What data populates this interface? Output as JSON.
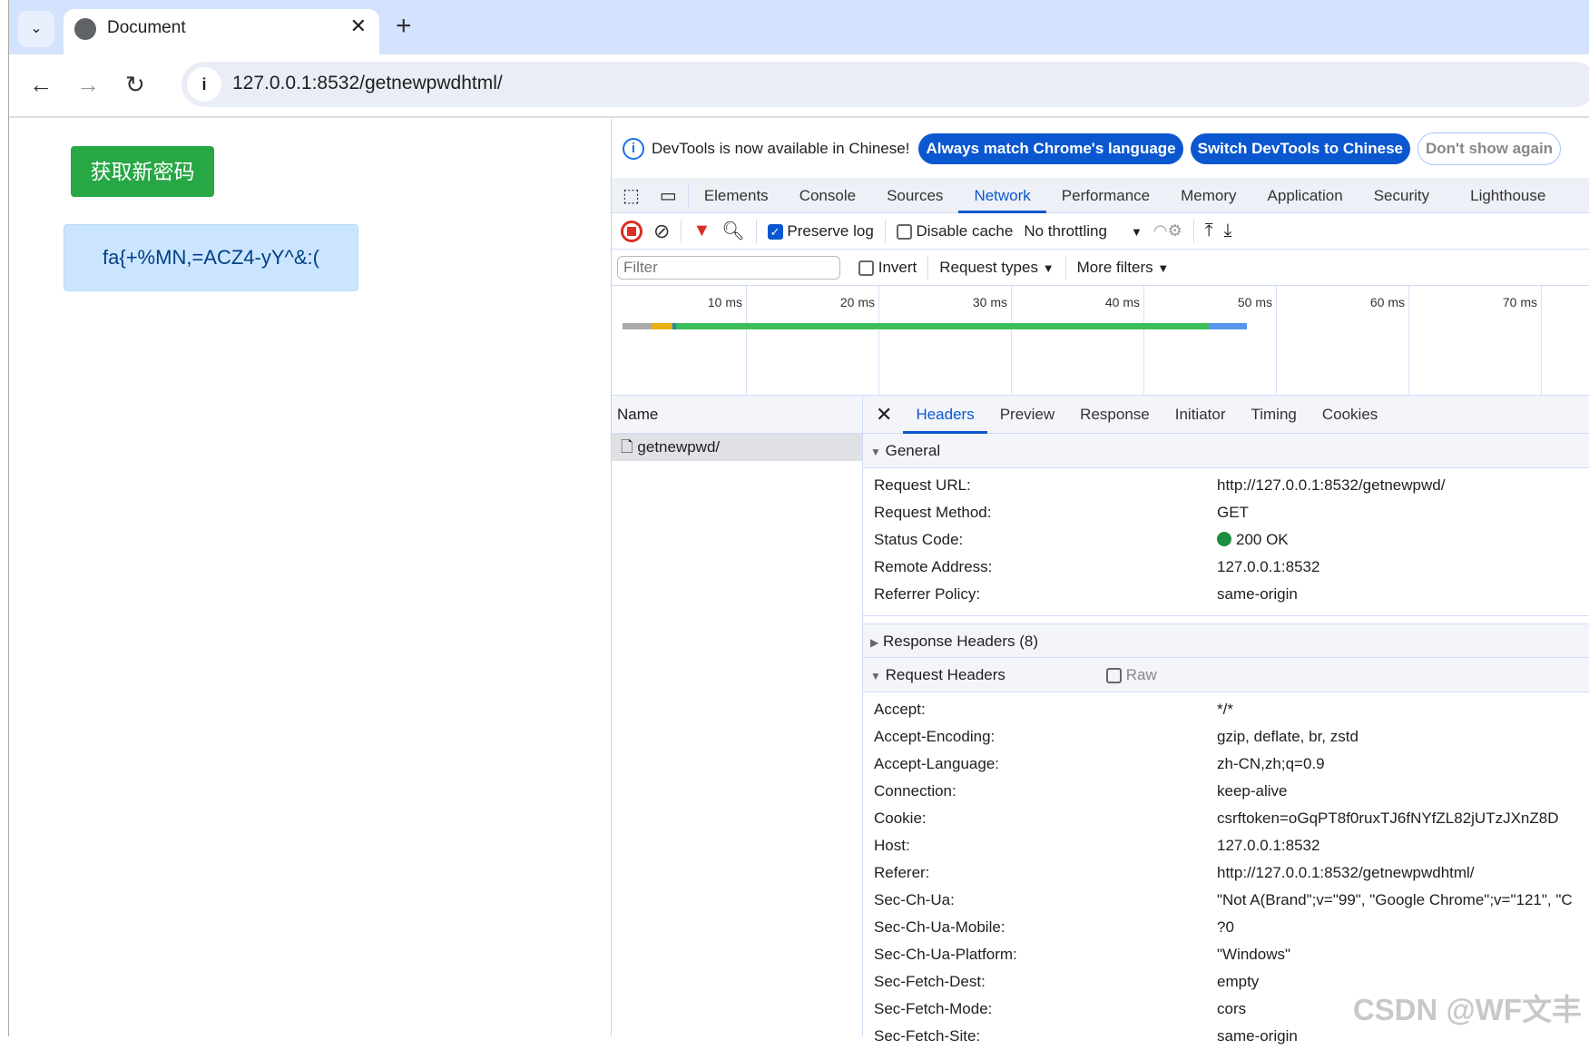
{
  "browser": {
    "tab_title": "Document",
    "url": "127.0.0.1:8532/getnewpwdhtml/"
  },
  "page": {
    "button_label": "获取新密码",
    "password": "fa{+%MN,=ACZ4-yY^&:("
  },
  "devtools": {
    "infobar": {
      "message": "DevTools is now available in Chinese!",
      "btn_match": "Always match Chrome's language",
      "btn_switch": "Switch DevTools to Chinese",
      "btn_dismiss": "Don't show again"
    },
    "panels": [
      "Elements",
      "Console",
      "Sources",
      "Network",
      "Performance",
      "Memory",
      "Application",
      "Security",
      "Lighthouse"
    ],
    "active_panel": "Network",
    "toolbar": {
      "preserve_log": "Preserve log",
      "preserve_checked": true,
      "disable_cache": "Disable cache",
      "disable_checked": false,
      "throttling": "No throttling"
    },
    "filter": {
      "placeholder": "Filter",
      "invert": "Invert",
      "request_types": "Request types",
      "more_filters": "More filters"
    },
    "timeline": {
      "ticks": [
        "10 ms",
        "20 ms",
        "30 ms",
        "40 ms",
        "50 ms",
        "60 ms",
        "70 ms"
      ]
    },
    "name_header": "Name",
    "request_name": "getnewpwd/",
    "detail_tabs": [
      "Headers",
      "Preview",
      "Response",
      "Initiator",
      "Timing",
      "Cookies"
    ],
    "active_detail_tab": "Headers",
    "general": {
      "title": "General",
      "rows": [
        {
          "k": "Request URL:",
          "v": "http://127.0.0.1:8532/getnewpwd/"
        },
        {
          "k": "Request Method:",
          "v": "GET"
        },
        {
          "k": "Status Code:",
          "v": "200 OK"
        },
        {
          "k": "Remote Address:",
          "v": "127.0.0.1:8532"
        },
        {
          "k": "Referrer Policy:",
          "v": "same-origin"
        }
      ]
    },
    "response_headers": "Response Headers (8)",
    "request_headers": {
      "title": "Request Headers",
      "raw": "Raw",
      "rows": [
        {
          "k": "Accept:",
          "v": "*/*"
        },
        {
          "k": "Accept-Encoding:",
          "v": "gzip, deflate, br, zstd"
        },
        {
          "k": "Accept-Language:",
          "v": "zh-CN,zh;q=0.9"
        },
        {
          "k": "Connection:",
          "v": "keep-alive"
        },
        {
          "k": "Cookie:",
          "v": "csrftoken=oGqPT8f0ruxTJ6fNYfZL82jUTzJXnZ8D"
        },
        {
          "k": "Host:",
          "v": "127.0.0.1:8532"
        },
        {
          "k": "Referer:",
          "v": "http://127.0.0.1:8532/getnewpwdhtml/"
        },
        {
          "k": "Sec-Ch-Ua:",
          "v": "\"Not A(Brand\";v=\"99\", \"Google Chrome\";v=\"121\", \"C"
        },
        {
          "k": "Sec-Ch-Ua-Mobile:",
          "v": "?0"
        },
        {
          "k": "Sec-Ch-Ua-Platform:",
          "v": "\"Windows\""
        },
        {
          "k": "Sec-Fetch-Dest:",
          "v": "empty"
        },
        {
          "k": "Sec-Fetch-Mode:",
          "v": "cors"
        },
        {
          "k": "Sec-Fetch-Site:",
          "v": "same-origin"
        }
      ]
    }
  },
  "watermark": "CSDN @WF文丰"
}
